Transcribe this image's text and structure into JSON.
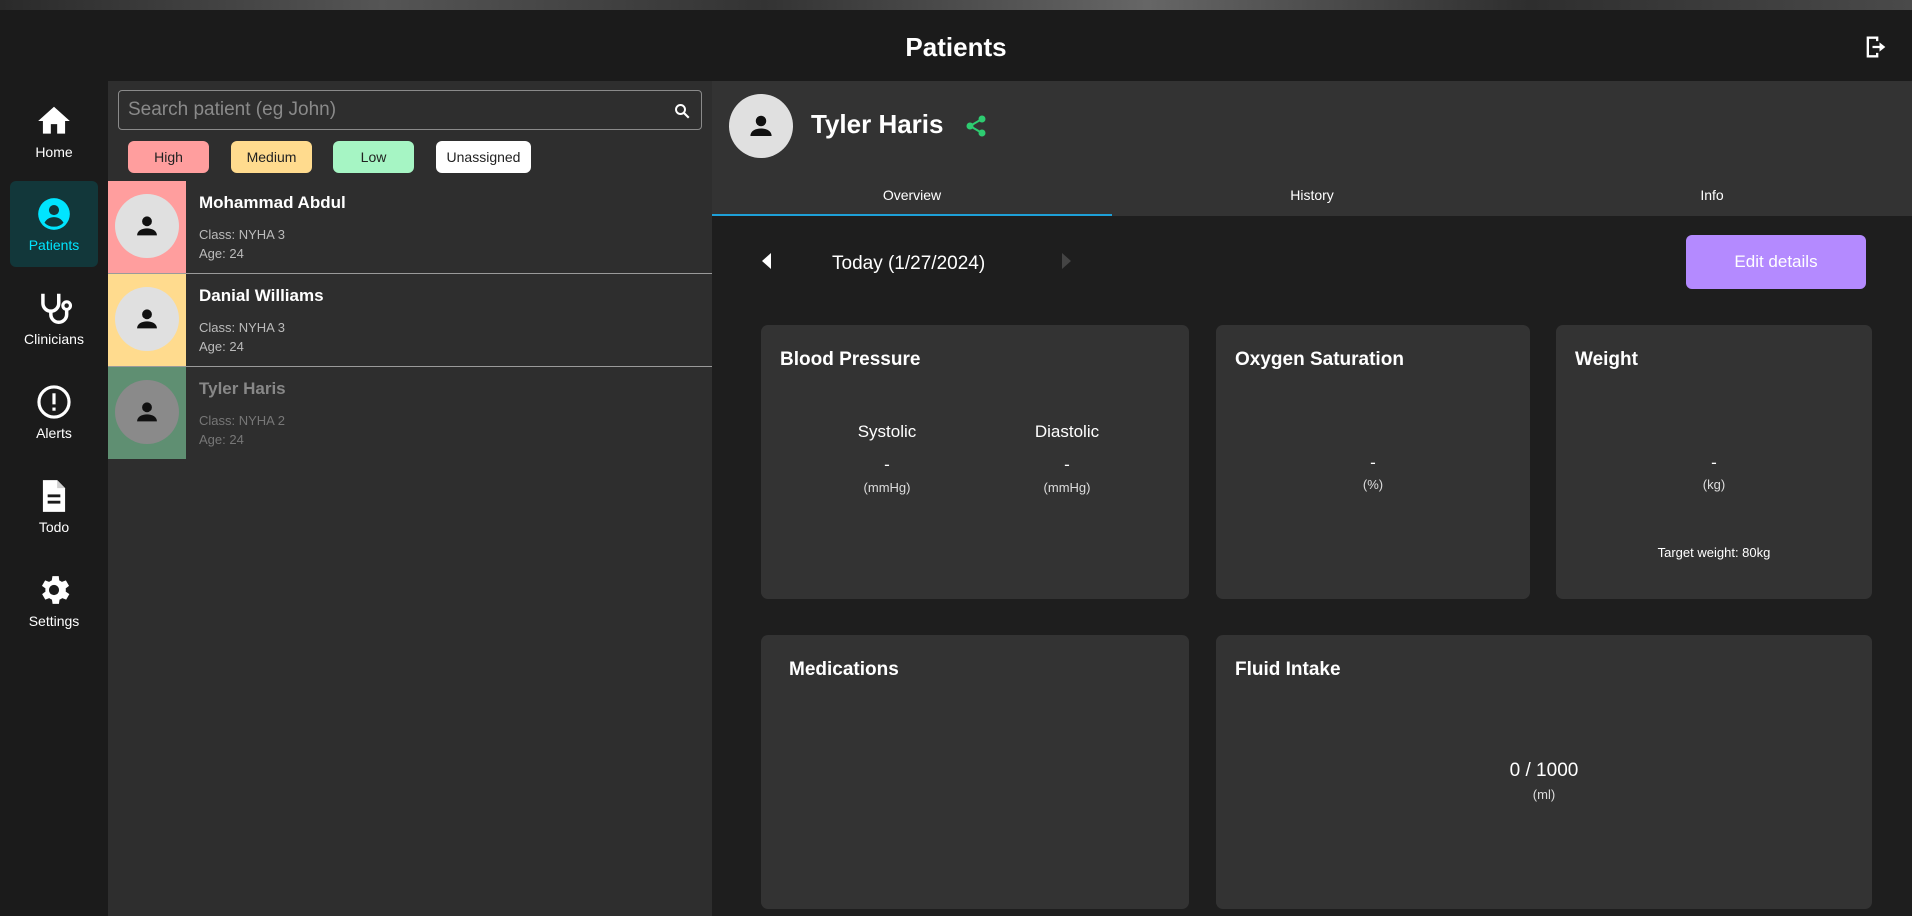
{
  "header": {
    "title": "Patients"
  },
  "nav": {
    "items": [
      {
        "label": "Home"
      },
      {
        "label": "Patients"
      },
      {
        "label": "Clinicians"
      },
      {
        "label": "Alerts"
      },
      {
        "label": "Todo"
      },
      {
        "label": "Settings"
      }
    ],
    "active_color": "#00e5ff"
  },
  "search": {
    "placeholder": "Search patient (eg John)",
    "value": ""
  },
  "filters": [
    {
      "label": "High",
      "color": "#ff9e9e"
    },
    {
      "label": "Medium",
      "color": "#ffdb8e"
    },
    {
      "label": "Low",
      "color": "#a6f5c4"
    },
    {
      "label": "Unassigned",
      "color": "#ffffff"
    }
  ],
  "patients": [
    {
      "name": "Mohammad Abdul",
      "class": "Class: NYHA 3",
      "age": "Age: 24",
      "priority_color": "#ff9e9e"
    },
    {
      "name": "Danial Williams",
      "class": "Class: NYHA 3",
      "age": "Age: 24",
      "priority_color": "#ffdb8e"
    },
    {
      "name": "Tyler Haris",
      "class": "Class: NYHA 2",
      "age": "Age: 24",
      "priority_color": "#5f8f72"
    }
  ],
  "detail": {
    "name": "Tyler Haris",
    "share_color": "#2ecc71",
    "tabs": [
      {
        "label": "Overview"
      },
      {
        "label": "History"
      },
      {
        "label": "Info"
      }
    ],
    "date": "Today (1/27/2024)",
    "edit_button": "Edit details",
    "blood_pressure": {
      "title": "Blood Pressure",
      "systolic_label": "Systolic",
      "systolic_value": "-",
      "systolic_unit": "(mmHg)",
      "diastolic_label": "Diastolic",
      "diastolic_value": "-",
      "diastolic_unit": "(mmHg)"
    },
    "oxygen": {
      "title": "Oxygen Saturation",
      "value": "-",
      "unit": "(%)"
    },
    "weight": {
      "title": "Weight",
      "value": "-",
      "unit": "(kg)",
      "target": "Target weight: 80kg"
    },
    "medications": {
      "title": "Medications"
    },
    "fluid": {
      "title": "Fluid Intake",
      "value": "0 / 1000",
      "unit": "(ml)"
    }
  }
}
